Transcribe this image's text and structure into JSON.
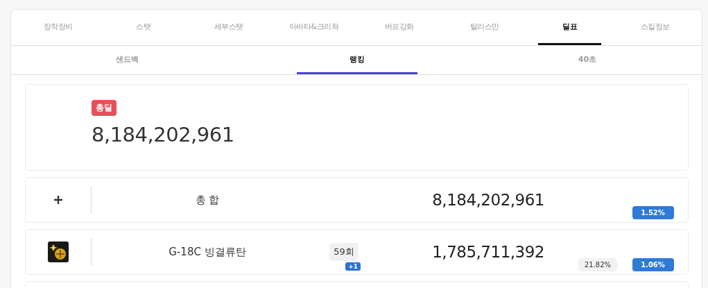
{
  "tabs": [
    {
      "label": "장착장비",
      "selected": false
    },
    {
      "label": "스탯",
      "selected": false
    },
    {
      "label": "세부스탯",
      "selected": false
    },
    {
      "label": "아바타&크리쳐",
      "selected": false
    },
    {
      "label": "버프강화",
      "selected": false
    },
    {
      "label": "탈리스만",
      "selected": false
    },
    {
      "label": "딜표",
      "selected": true
    },
    {
      "label": "스킬정보",
      "selected": false
    }
  ],
  "sub_tabs": [
    {
      "label": "샌드백",
      "selected": false
    },
    {
      "label": "랭킹",
      "selected": true
    },
    {
      "label": "40초",
      "selected": false
    }
  ],
  "summary": {
    "badge": "총딜",
    "total": "8,184,202,961"
  },
  "rows": [
    {
      "kind": "total",
      "name": "총 합",
      "damage": "8,184,202,961",
      "change": "1.52%"
    },
    {
      "kind": "skill",
      "name": "G-18C 빙결류탄",
      "count": "59회",
      "count_delta": "+1",
      "damage": "1,785,711,392",
      "share": "21.82%",
      "change": "1.06%"
    }
  ]
}
